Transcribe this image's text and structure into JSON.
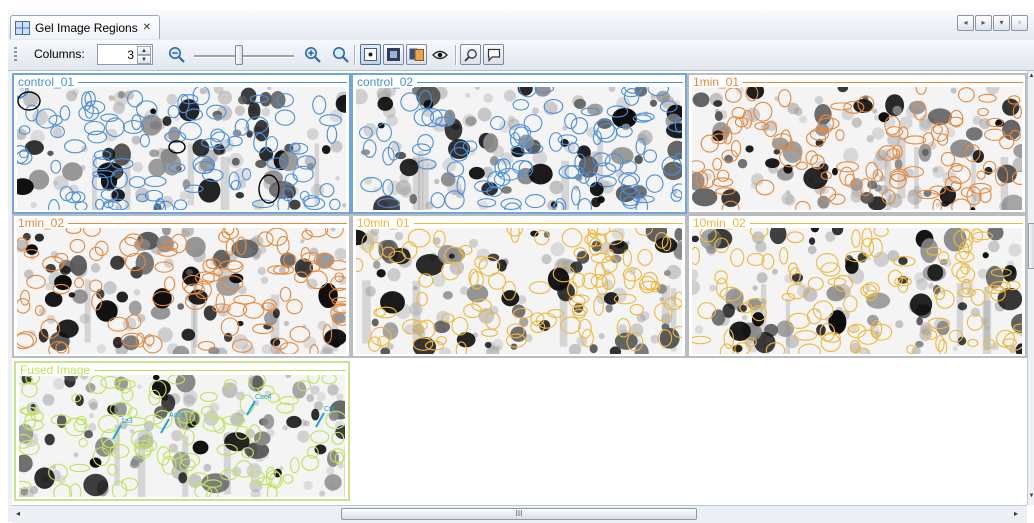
{
  "window": {
    "tab_title": "Gel Image Regions",
    "tab_close": "✕"
  },
  "window_controls": [
    "◂",
    "▸",
    "▾",
    "▫"
  ],
  "toolbar": {
    "columns_label": "Columns:",
    "columns_value": "3",
    "zoom_slider_level": 0.45,
    "icons": [
      "zoom-out-icon",
      "zoom-in-icon",
      "zoom-fit-icon",
      "show-spots-icon",
      "show-image-icon",
      "overlay-icon",
      "visibility-eye-icon",
      "find-icon",
      "annotation-icon"
    ]
  },
  "colors": {
    "control": "#4a8fdc",
    "min1": "#e8883a",
    "min10": "#f0b83a",
    "fused": "#bfe35a",
    "highlight": "#1ea0e6"
  },
  "panels": [
    {
      "title": "control_01",
      "color": "#4a8fdc",
      "seed": 11
    },
    {
      "title": "control_02",
      "color": "#4a8fdc",
      "seed": 12
    },
    {
      "title": "1min_01",
      "color": "#e8883a",
      "seed": 23
    },
    {
      "title": "1min_02",
      "color": "#e8883a",
      "seed": 24
    },
    {
      "title": "10min_01",
      "color": "#f0b83a",
      "seed": 35
    },
    {
      "title": "10min_02",
      "color": "#f0b83a",
      "seed": 36
    },
    {
      "title": "Fused Image",
      "color": "#bfe35a",
      "seed": 47,
      "annotations": [
        "Acd1",
        "1a3",
        "Cac4",
        "Ct4"
      ]
    }
  ],
  "hscroll_grip": "III"
}
